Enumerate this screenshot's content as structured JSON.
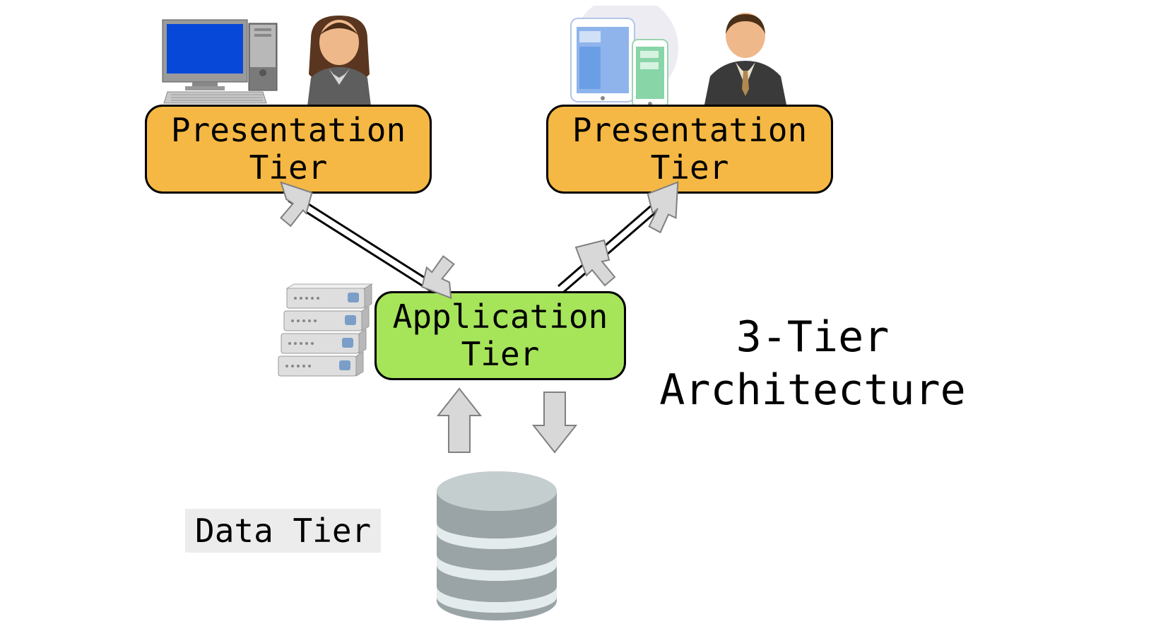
{
  "title": {
    "line1": "3-Tier",
    "line2": "Architecture"
  },
  "tiers": {
    "presentation_left": {
      "line1": "Presentation",
      "line2": "Tier"
    },
    "presentation_right": {
      "line1": "Presentation",
      "line2": "Tier"
    },
    "application": {
      "line1": "Application",
      "line2": "Tier"
    },
    "data": "Data Tier"
  },
  "colors": {
    "orange": "#f5b844",
    "green": "#a6e45a",
    "gray_bg": "#ececec"
  },
  "icons": {
    "desktop": "desktop-computer-icon",
    "female_user": "female-user-icon",
    "mobile_devices": "mobile-devices-icon",
    "male_user": "male-user-icon",
    "server_rack": "server-rack-icon",
    "database": "database-icon"
  }
}
